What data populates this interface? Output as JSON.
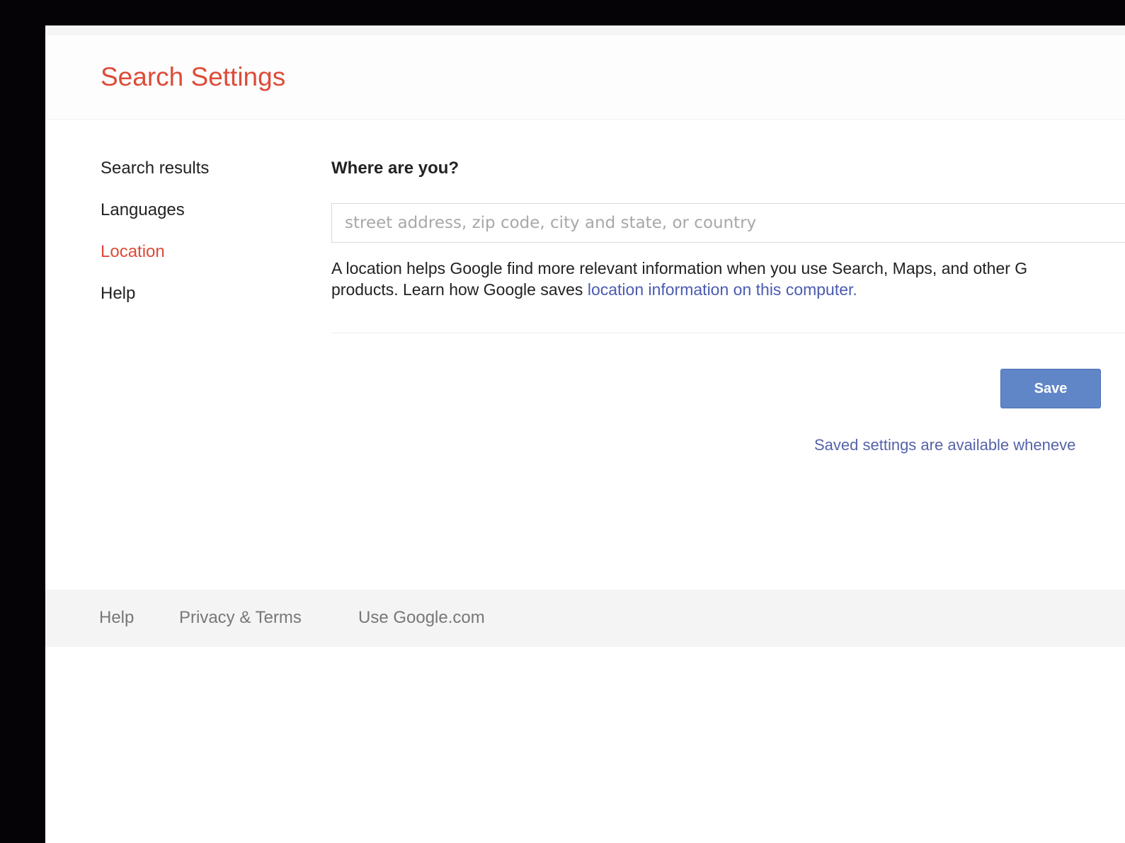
{
  "header": {
    "title": "Search Settings"
  },
  "sidebar": {
    "items": [
      {
        "label": "Search results"
      },
      {
        "label": "Languages"
      },
      {
        "label": "Location"
      },
      {
        "label": "Help"
      }
    ],
    "active": "Location"
  },
  "location": {
    "title": "Where are you?",
    "placeholder": "street address, zip code, city and state, or country",
    "value": "",
    "description_line1": "A location helps Google find more relevant information when you use Search, Maps, and other G",
    "description_line2_prefix": "products. Learn how Google saves ",
    "description_link": "location information on this computer."
  },
  "actions": {
    "save_label": "Save",
    "saved_note": "Saved settings are available wheneve"
  },
  "footer": {
    "links": [
      {
        "label": "Help"
      },
      {
        "label": "Privacy & Terms"
      },
      {
        "label": "Use Google.com"
      }
    ]
  },
  "colors": {
    "brand_red": "#dd4b39",
    "link_blue": "#4a5bb0",
    "button_blue": "#6186c8",
    "bezel": "#050306"
  }
}
